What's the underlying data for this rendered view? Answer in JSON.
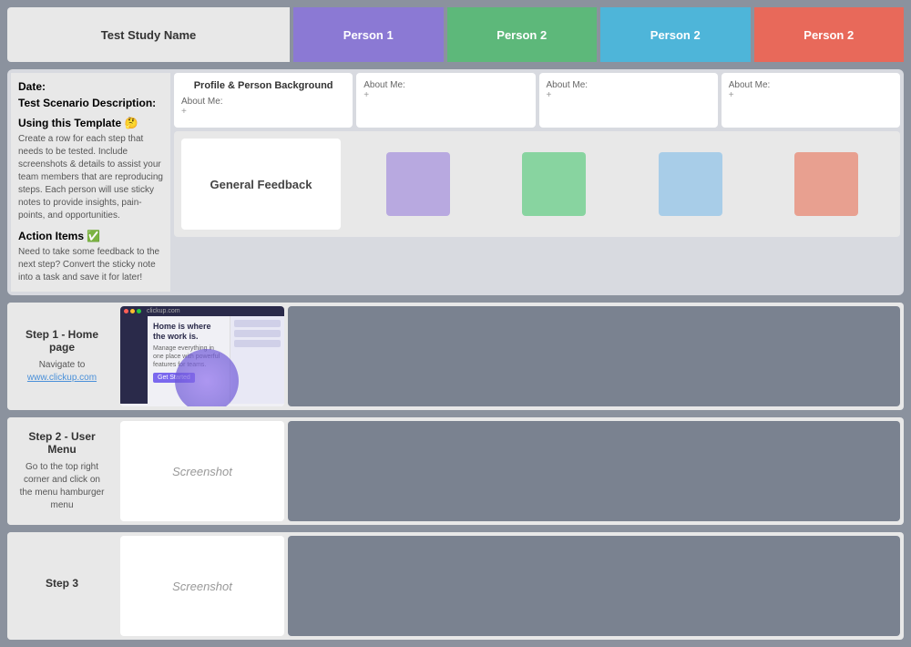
{
  "header": {
    "title": "Test Study Name",
    "person1_label": "Person 1",
    "person2a_label": "Person 2",
    "person2b_label": "Person 2",
    "person2c_label": "Person 2"
  },
  "sidebar": {
    "date_label": "Date:",
    "scenario_label": "Test Scenario Description:",
    "template_label": "Using this Template 🤔",
    "template_desc": "Create a row for each step that needs to be tested. Include screenshots & details to assist your team members that are reproducing steps. Each person will use sticky notes to provide insights, pain-points, and opportunities.",
    "action_label": "Action Items ✅",
    "action_desc": "Need to take some feedback to the next step? Convert the sticky note into a task and save it for later!"
  },
  "profile_section": {
    "cards": [
      {
        "title": "Profile & Person Background",
        "about_label": "About Me:",
        "about_value": "+"
      },
      {
        "title": "",
        "about_label": "About Me:",
        "about_value": "+"
      },
      {
        "title": "",
        "about_label": "About Me:",
        "about_value": "+"
      },
      {
        "title": "",
        "about_label": "About Me:",
        "about_value": "+"
      }
    ]
  },
  "feedback_section": {
    "label": "General Feedback"
  },
  "steps": [
    {
      "id": "step1",
      "title": "Step 1 - Home page",
      "desc": "Navigate to",
      "link_text": "www.clickup.com",
      "has_real_screenshot": true,
      "screenshot_label": ""
    },
    {
      "id": "step2",
      "title": "Step 2 - User Menu",
      "desc": "Go to the top right corner and click on the menu hamburger menu",
      "link_text": "",
      "has_real_screenshot": false,
      "screenshot_label": "Screenshot"
    },
    {
      "id": "step3",
      "title": "Step 3",
      "desc": "",
      "link_text": "",
      "has_real_screenshot": false,
      "screenshot_label": "Screenshot"
    }
  ]
}
